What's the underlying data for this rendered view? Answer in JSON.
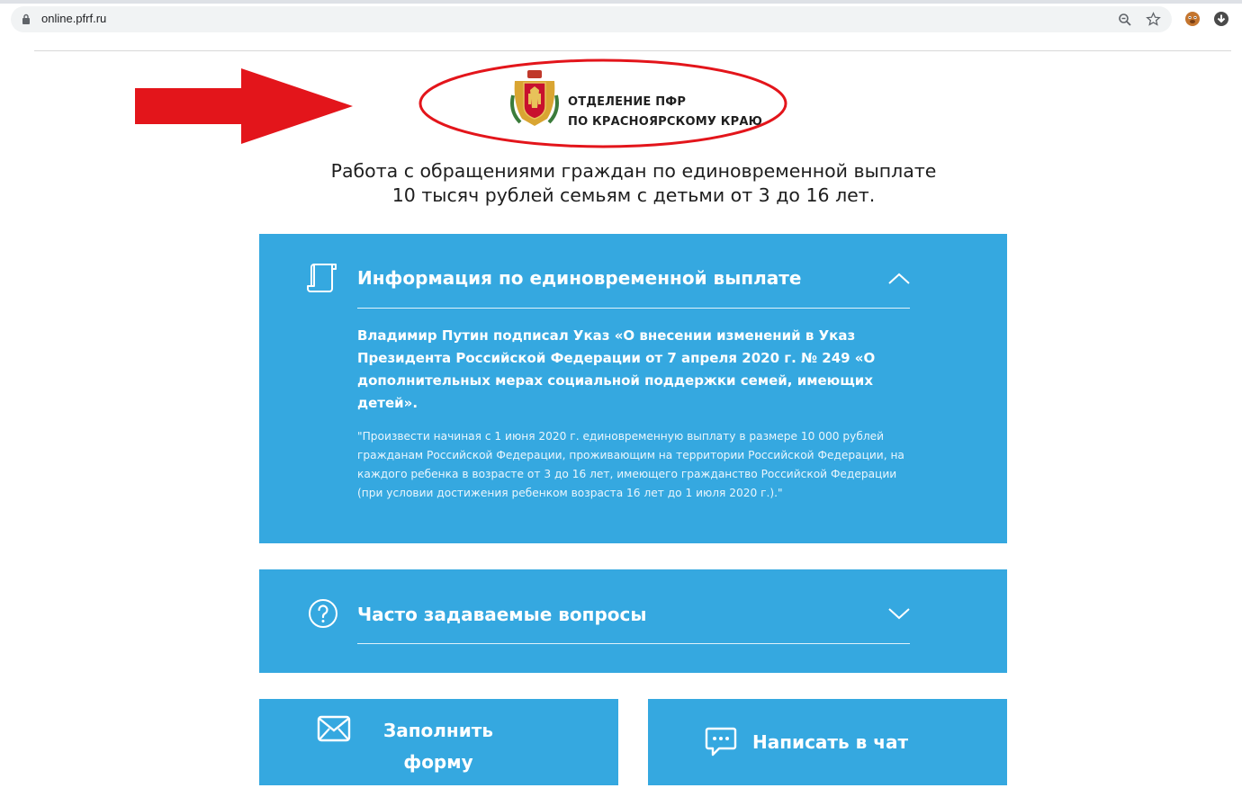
{
  "browser": {
    "url": "online.pfrf.ru",
    "icons": [
      "lock-icon",
      "zoom-icon",
      "star-icon",
      "extension-icon",
      "download-icon"
    ]
  },
  "header": {
    "logo_line1": "ОТДЕЛЕНИЕ ПФР",
    "logo_line2": "ПО КРАСНОЯРСКОМУ КРАЮ"
  },
  "page": {
    "title_line1": "Работа с обращениями граждан по единовременной выплате",
    "title_line2": "10 тысяч рублей семьям с детьми от 3 до 16 лет."
  },
  "info_panel": {
    "icon": "document-scroll-icon",
    "heading": "Информация по единовременной выплате",
    "expanded": true,
    "lead_text": "Владимир Путин подписал Указ «О внесении изменений в Указ Президента Российской Федерации от 7 апреля 2020 г. № 249 «О дополнительных мерах социальной поддержки семей, имеющих детей».",
    "quote_text": "\"Произвести начиная с 1 июня 2020 г. единовременную выплату в размере 10 000 рублей гражданам Российской Федерации, проживающим на территории Российской Федерации, на каждого ребенка в возрасте от 3 до 16 лет, имеющего гражданство Российской Федерации (при условии достижения ребенком возраста 16 лет до 1 июля 2020 г.).\""
  },
  "faq_panel": {
    "icon": "question-circle-icon",
    "heading": "Часто задаваемые вопросы",
    "expanded": false
  },
  "actions": {
    "form_line1": "Заполнить",
    "form_line2": "форму",
    "form_icon": "envelope-icon",
    "chat_label": "Написать в чат",
    "chat_icon": "chat-bubbles-icon"
  },
  "colors": {
    "panel_blue": "#35a8e0",
    "annotation_red": "#e3151b"
  }
}
